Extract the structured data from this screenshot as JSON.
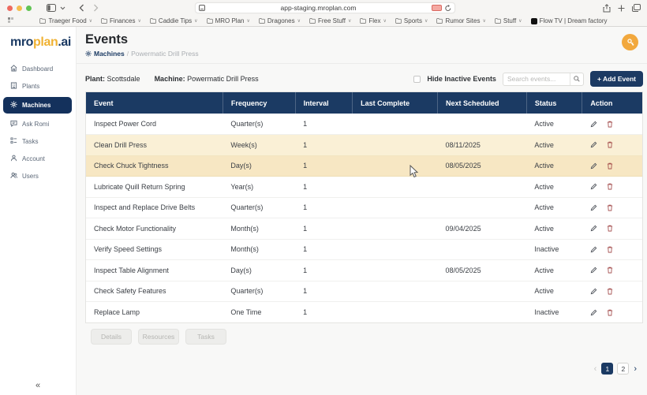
{
  "browser": {
    "url": "app-staging.mroplan.com",
    "bookmarks": [
      {
        "label": "Traeger Food",
        "icon": "folder",
        "dropdown": true
      },
      {
        "label": "Finances",
        "icon": "folder",
        "dropdown": true
      },
      {
        "label": "Caddie Tips",
        "icon": "folder",
        "dropdown": true
      },
      {
        "label": "MRO Plan",
        "icon": "folder",
        "dropdown": true
      },
      {
        "label": "Dragones",
        "icon": "folder",
        "dropdown": true
      },
      {
        "label": "Free Stuff",
        "icon": "folder",
        "dropdown": true
      },
      {
        "label": "Flex",
        "icon": "folder",
        "dropdown": true
      },
      {
        "label": "Sports",
        "icon": "folder",
        "dropdown": true
      },
      {
        "label": "Rumor Sites",
        "icon": "folder",
        "dropdown": true
      },
      {
        "label": "Stuff",
        "icon": "folder",
        "dropdown": true
      },
      {
        "label": "Flow TV | Dream factory",
        "icon": "site",
        "dropdown": false
      }
    ]
  },
  "sidebar": {
    "logo": {
      "part1": "mro",
      "part2": "plan",
      "part3": ".ai"
    },
    "items": [
      {
        "label": "Dashboard",
        "icon": "home-icon",
        "active": false
      },
      {
        "label": "Plants",
        "icon": "plant-icon",
        "active": false
      },
      {
        "label": "Machines",
        "icon": "machine-icon",
        "active": true
      },
      {
        "label": "Ask Romi",
        "icon": "chat-icon",
        "active": false
      },
      {
        "label": "Tasks",
        "icon": "tasks-icon",
        "active": false
      },
      {
        "label": "Account",
        "icon": "person-icon",
        "active": false
      },
      {
        "label": "Users",
        "icon": "users-icon",
        "active": false
      }
    ],
    "collapse_glyph": "«"
  },
  "header": {
    "title": "Events",
    "breadcrumb": {
      "machines": "Machines",
      "separator": "/",
      "current": "Powermatic Drill Press"
    }
  },
  "toolbar": {
    "plant_label": "Plant:",
    "plant_value": "Scottsdale",
    "machine_label": "Machine:",
    "machine_value": "Powermatic Drill Press",
    "hide_inactive_label": "Hide Inactive Events",
    "search_placeholder": "Search events...",
    "add_event_label": "+ Add Event"
  },
  "table": {
    "columns": [
      "Event",
      "Frequency",
      "Interval",
      "Last Complete",
      "Next Scheduled",
      "Status",
      "Action"
    ],
    "rows": [
      {
        "event": "Inspect Power Cord",
        "frequency": "Quarter(s)",
        "interval": "1",
        "last_complete": "",
        "next_scheduled": "",
        "status": "Active",
        "highlight": "none"
      },
      {
        "event": "Clean Drill Press",
        "frequency": "Week(s)",
        "interval": "1",
        "last_complete": "",
        "next_scheduled": "08/11/2025",
        "status": "Active",
        "highlight": "cream"
      },
      {
        "event": "Check Chuck Tightness",
        "frequency": "Day(s)",
        "interval": "1",
        "last_complete": "",
        "next_scheduled": "08/05/2025",
        "status": "Active",
        "highlight": "cream-dark"
      },
      {
        "event": "Lubricate Quill Return Spring",
        "frequency": "Year(s)",
        "interval": "1",
        "last_complete": "",
        "next_scheduled": "",
        "status": "Active",
        "highlight": "none"
      },
      {
        "event": "Inspect and Replace Drive Belts",
        "frequency": "Quarter(s)",
        "interval": "1",
        "last_complete": "",
        "next_scheduled": "",
        "status": "Active",
        "highlight": "none"
      },
      {
        "event": "Check Motor Functionality",
        "frequency": "Month(s)",
        "interval": "1",
        "last_complete": "",
        "next_scheduled": "09/04/2025",
        "status": "Active",
        "highlight": "none"
      },
      {
        "event": "Verify Speed Settings",
        "frequency": "Month(s)",
        "interval": "1",
        "last_complete": "",
        "next_scheduled": "",
        "status": "Inactive",
        "highlight": "none"
      },
      {
        "event": "Inspect Table Alignment",
        "frequency": "Day(s)",
        "interval": "1",
        "last_complete": "",
        "next_scheduled": "08/05/2025",
        "status": "Active",
        "highlight": "none"
      },
      {
        "event": "Check Safety Features",
        "frequency": "Quarter(s)",
        "interval": "1",
        "last_complete": "",
        "next_scheduled": "",
        "status": "Active",
        "highlight": "none"
      },
      {
        "event": "Replace Lamp",
        "frequency": "One Time",
        "interval": "1",
        "last_complete": "",
        "next_scheduled": "",
        "status": "Inactive",
        "highlight": "none"
      }
    ]
  },
  "footer_buttons": [
    "Details",
    "Resources",
    "Tasks"
  ],
  "pagination": {
    "prev": "‹",
    "pages": [
      "1",
      "2"
    ],
    "active_page": "1",
    "next": "›"
  },
  "colors": {
    "navy": "#1b3a63",
    "logo_yellow": "#f0b233",
    "row_highlight": "#faf0d6",
    "row_highlight_hover": "#f7e7c3",
    "avatar_orange": "#f2a83d",
    "delete_red": "#9d4040"
  }
}
